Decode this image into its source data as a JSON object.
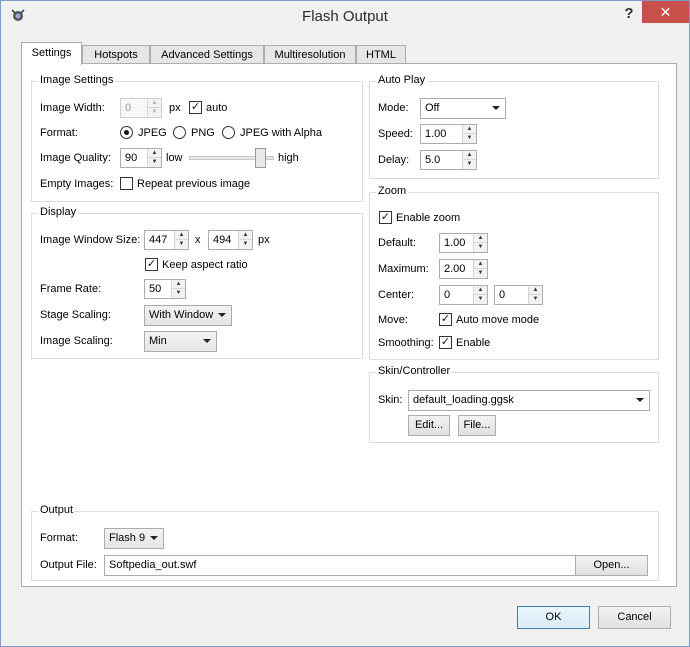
{
  "window": {
    "title": "Flash Output",
    "help_glyph": "?",
    "close_glyph": "✕"
  },
  "tabs": [
    {
      "label": "Settings"
    },
    {
      "label": "Hotspots"
    },
    {
      "label": "Advanced Settings"
    },
    {
      "label": "Multiresolution"
    },
    {
      "label": "HTML"
    }
  ],
  "image_settings": {
    "title": "Image Settings",
    "width_label": "Image Width:",
    "width_value": "0",
    "width_unit": "px",
    "auto_label": "auto",
    "auto_checked": true,
    "format_label": "Format:",
    "formats": [
      "JPEG",
      "PNG",
      "JPEG with Alpha"
    ],
    "format_selected": "JPEG",
    "quality_label": "Image Quality:",
    "quality_value": "90",
    "quality_low": "low",
    "quality_high": "high",
    "quality_slider_level": 0.9,
    "empty_label": "Empty Images:",
    "repeat_label": "Repeat previous image",
    "repeat_checked": false
  },
  "display": {
    "title": "Display",
    "window_size_label": "Image Window Size:",
    "width_value": "447",
    "x_sep": "x",
    "height_value": "494",
    "unit": "px",
    "keep_aspect_label": "Keep aspect ratio",
    "keep_aspect_checked": true,
    "frame_rate_label": "Frame Rate:",
    "frame_rate_value": "50",
    "stage_scaling_label": "Stage Scaling:",
    "stage_scaling_value": "With Window",
    "image_scaling_label": "Image Scaling:",
    "image_scaling_value": "Min"
  },
  "auto_play": {
    "title": "Auto Play",
    "mode_label": "Mode:",
    "mode_value": "Off",
    "speed_label": "Speed:",
    "speed_value": "1.00",
    "delay_label": "Delay:",
    "delay_value": "5.0"
  },
  "zoom": {
    "title": "Zoom",
    "enable_label": "Enable zoom",
    "enable_checked": true,
    "default_label": "Default:",
    "default_value": "1.00",
    "max_label": "Maximum:",
    "max_value": "2.00",
    "center_label": "Center:",
    "center_x": "0",
    "center_y": "0",
    "move_label": "Move:",
    "auto_move_label": "Auto move mode",
    "auto_move_checked": true,
    "smoothing_label": "Smoothing:",
    "smoothing_enable_label": "Enable",
    "smoothing_checked": true
  },
  "skin": {
    "title": "Skin/Controller",
    "skin_label": "Skin:",
    "skin_value": "default_loading.ggsk",
    "edit_label": "Edit...",
    "file_label": "File..."
  },
  "output": {
    "title": "Output",
    "format_label": "Format:",
    "format_value": "Flash 9",
    "file_label": "Output File:",
    "file_value": "Softpedia_out.swf",
    "open_label": "Open..."
  },
  "footer": {
    "ok_label": "OK",
    "cancel_label": "Cancel"
  }
}
